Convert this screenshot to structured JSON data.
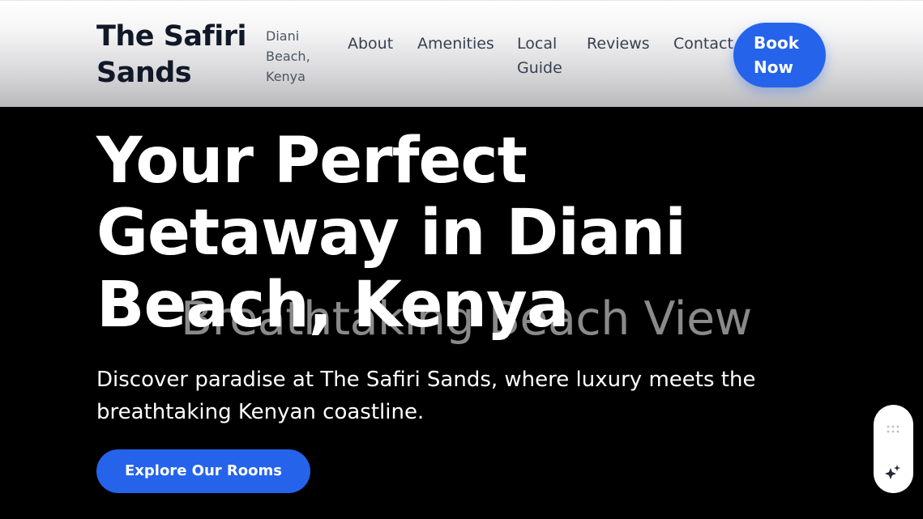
{
  "header": {
    "brand_line1": "The Safiri",
    "brand_line2": "Sands",
    "location_line1": "Diani",
    "location_line2": "Beach,",
    "location_line3": "Kenya",
    "nav": {
      "about": "About",
      "amenities": "Amenities",
      "local_guide": "Local Guide",
      "reviews": "Reviews",
      "contact": "Contact"
    },
    "book_line1": "Book",
    "book_line2": "Now"
  },
  "hero": {
    "background_caption": "Breathtaking Beach View",
    "title": "Your Perfect Getaway in Diani Beach, Kenya",
    "subtitle": "Discover paradise at The Safiri Sands, where luxury meets the breathtaking Kenyan coastline.",
    "cta": "Explore Our Rooms"
  },
  "widget": {
    "icons": [
      "grip-dots-icon",
      "sparkle-icon"
    ]
  },
  "colors": {
    "accent": "#2563eb",
    "text_dark": "#111827",
    "nav_text": "#374151",
    "hero_bg": "#000000"
  }
}
